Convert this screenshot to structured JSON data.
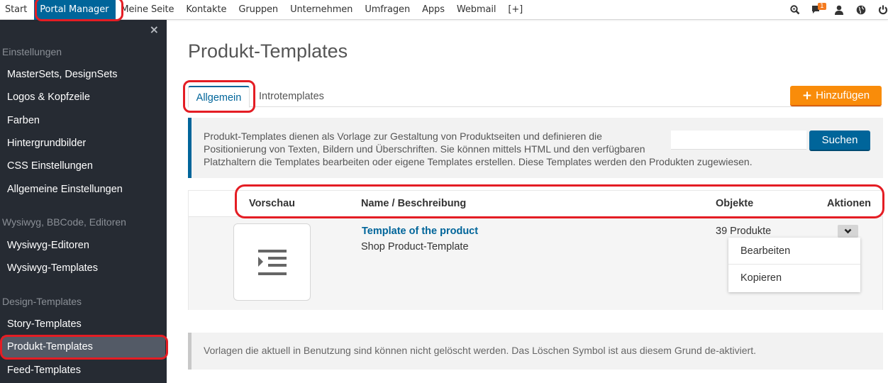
{
  "topnav": {
    "items": [
      {
        "label": "Start",
        "active": false
      },
      {
        "label": "Portal Manager",
        "active": true
      },
      {
        "label": "Meine Seite",
        "active": false
      },
      {
        "label": "Kontakte",
        "active": false
      },
      {
        "label": "Gruppen",
        "active": false
      },
      {
        "label": "Unternehmen",
        "active": false
      },
      {
        "label": "Umfragen",
        "active": false
      },
      {
        "label": "Apps",
        "active": false
      },
      {
        "label": "Webmail",
        "active": false
      },
      {
        "label": "[+]",
        "active": false
      }
    ],
    "icons": [
      {
        "name": "search-icon"
      },
      {
        "name": "messages-icon",
        "badge": "1"
      },
      {
        "name": "user-icon"
      },
      {
        "name": "globe-icon"
      },
      {
        "name": "power-icon"
      }
    ],
    "messages_badge": "1"
  },
  "sidebar": {
    "close_label": "×",
    "sections": [
      {
        "title": "Einstellungen",
        "items": [
          "MasterSets, DesignSets",
          "Logos & Kopfzeile",
          "Farben",
          "Hintergrundbilder",
          "CSS Einstellungen",
          "Allgemeine Einstellungen"
        ]
      },
      {
        "title": "Wysiwyg, BBCode, Editoren",
        "items": [
          "Wysiwyg-Editoren",
          "Wysiwyg-Templates"
        ]
      },
      {
        "title": "Design-Templates",
        "items": [
          "Story-Templates",
          "Produkt-Templates",
          "Feed-Templates"
        ]
      }
    ],
    "active_item": "Produkt-Templates"
  },
  "main": {
    "title": "Produkt-Templates",
    "tabs": [
      {
        "label": "Allgemein",
        "active": true
      },
      {
        "label": "Introtemplates",
        "active": false
      }
    ],
    "add_button": {
      "icon": "+",
      "label": "Hinzufügen"
    },
    "info": {
      "lines": [
        "Produkt-Templates dienen als Vorlage zur Gestaltung von Produktseiten und definieren die",
        "Positionierung von Texten, Bildern und Überschriften. Sie können mittels HTML und den verfügbaren",
        "Platzhaltern die Templates bearbeiten oder eigene Templates erstellen. Diese Templates werden den Produkten zugewiesen."
      ]
    },
    "search": {
      "value": "",
      "placeholder": "",
      "button_label": "Suchen"
    },
    "table": {
      "headers": [
        "Vorschau",
        "Name / Beschreibung",
        "Objekte",
        "Aktionen"
      ],
      "rows": [
        {
          "preview_icon": "indent-icon",
          "name": "Template of the product",
          "description": "Shop Product-Template",
          "objects": "39 Produkte"
        }
      ]
    },
    "actions_menu": {
      "open": true,
      "items": [
        "Bearbeiten",
        "Kopieren"
      ]
    },
    "note": "Vorlagen die aktuell in Benutzung sind können nicht gelöscht werden. Das Löschen Symbol ist aus diesem Grund de-aktiviert."
  },
  "colors": {
    "primary": "#00659a",
    "accent": "#f98c0a",
    "sidebar_bg": "#262b33",
    "highlight": "#e41d24"
  }
}
